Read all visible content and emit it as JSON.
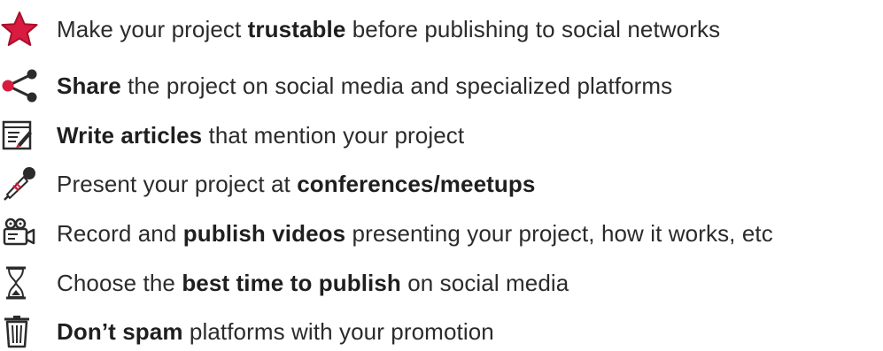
{
  "items": [
    {
      "icon": "star-icon",
      "before": "Make your project ",
      "bold": "trustable",
      "after": " before publishing to social networks"
    },
    {
      "icon": "share-icon",
      "before": "",
      "bold": "Share",
      "after": " the project on social media and specialized platforms"
    },
    {
      "icon": "memo-icon",
      "before": "",
      "bold": "Write articles",
      "after": " that mention your project"
    },
    {
      "icon": "microphone-icon",
      "before": "Present your project at ",
      "bold": "conferences/meetups",
      "after": ""
    },
    {
      "icon": "movie-camera-icon",
      "before": "Record and ",
      "bold": "publish videos",
      "after": " presenting your project, how it works, etc"
    },
    {
      "icon": "hourglass-icon",
      "before": "Choose the ",
      "bold": "best time to publish",
      "after": " on social media"
    },
    {
      "icon": "trash-icon",
      "before": "",
      "bold": "Don’t spam",
      "after": " platforms with your promotion"
    }
  ],
  "colors": {
    "star": "#d81b3f",
    "share": "#2b2b2b",
    "text": "#2b2b2b"
  }
}
